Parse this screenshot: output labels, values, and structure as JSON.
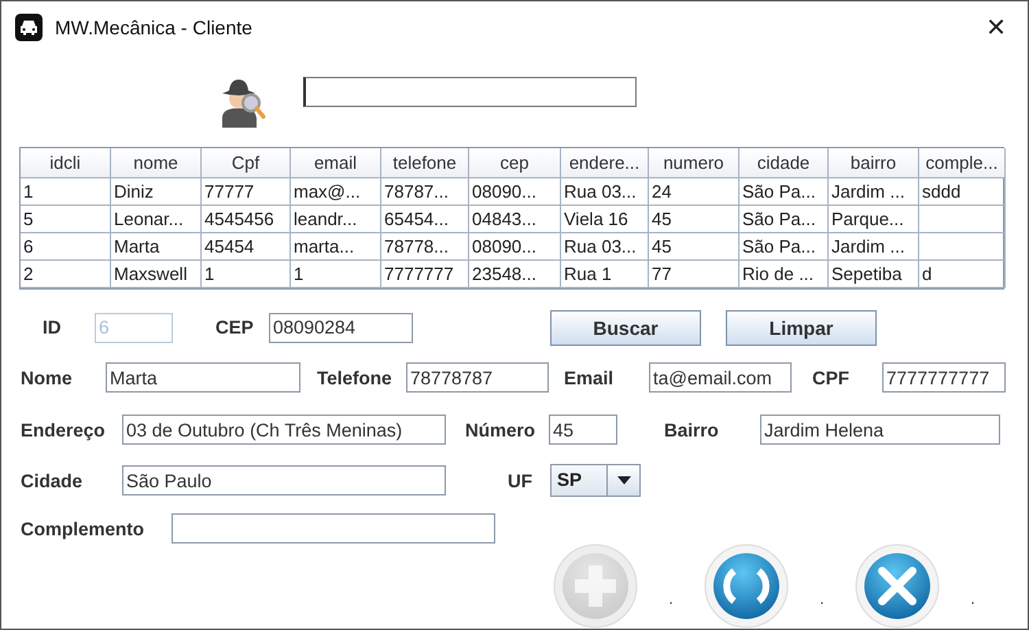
{
  "window": {
    "title": "MW.Mecânica - Cliente",
    "close": "✕"
  },
  "table": {
    "columns": [
      "idcli",
      "nome",
      "Cpf",
      "email",
      "telefone",
      "cep",
      "endere...",
      "numero",
      "cidade",
      "bairro",
      "comple..."
    ],
    "rows": [
      [
        "1",
        "Diniz",
        "77777",
        "max@...",
        "78787...",
        "08090...",
        "Rua 03...",
        "24",
        "São Pa...",
        "Jardim ...",
        "sddd"
      ],
      [
        "5",
        "Leonar...",
        "4545456",
        "leandr...",
        "65454...",
        "04843...",
        "Viela 16",
        "45",
        "São Pa...",
        "Parque...",
        ""
      ],
      [
        "6",
        "Marta",
        "45454",
        "marta...",
        "78778...",
        "08090...",
        "Rua 03...",
        "45",
        "São Pa...",
        "Jardim ...",
        ""
      ],
      [
        "2",
        "Maxswell",
        "1",
        "1",
        "7777777",
        "23548...",
        "Rua 1",
        "77",
        "Rio de ...",
        "Sepetiba",
        "d"
      ]
    ]
  },
  "form": {
    "rows": [
      [
        {
          "label": "ID",
          "value": "6",
          "disabled": true
        },
        {
          "label": "CEP",
          "value": "08090284",
          "disabled": false
        }
      ],
      [
        {
          "label": "Nome",
          "value": "Marta",
          "disabled": false
        },
        {
          "label": "Telefone",
          "value": "78778787",
          "disabled": false
        },
        {
          "label": "Email",
          "value": "ta@email.com",
          "disabled": false
        },
        {
          "label": "CPF",
          "value": "7777777777",
          "disabled": false
        }
      ],
      [
        {
          "label": "Endereço",
          "value": "03 de Outubro (Ch Três Meninas)",
          "disabled": false
        },
        {
          "label": "Número",
          "value": "45",
          "disabled": false
        },
        {
          "label": "Bairro",
          "value": "Jardim Helena",
          "disabled": false
        }
      ],
      [
        {
          "label": "Cidade",
          "value": "São Paulo",
          "disabled": false
        },
        {
          "label": "UF",
          "value": "SP",
          "kind": "combo"
        }
      ],
      [
        {
          "label": "Complemento",
          "disabled": false
        }
      ]
    ]
  },
  "buttons": [
    "Buscar",
    "Limpar"
  ],
  "actions": [
    {
      "kind": "add",
      "disabled": true,
      "caption": "."
    },
    {
      "kind": "refresh",
      "disabled": false,
      "caption": "."
    },
    {
      "kind": "close",
      "disabled": false,
      "caption": "."
    }
  ]
}
